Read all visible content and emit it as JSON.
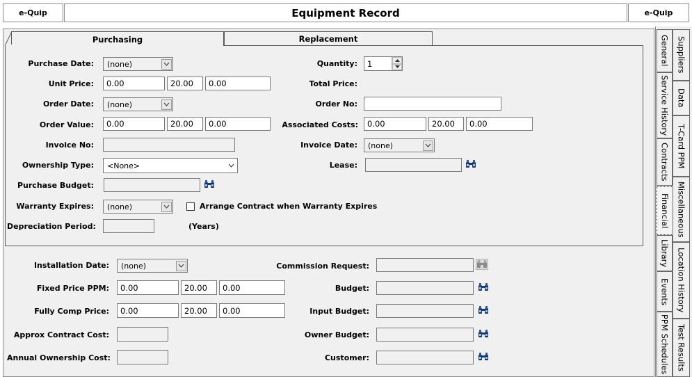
{
  "header": {
    "left_button": "e-Quip",
    "title": "Equipment Record",
    "right_button": "e-Quip"
  },
  "tabs": {
    "purchasing": "Purchasing",
    "replacement": "Replacement"
  },
  "purchasing": {
    "purchase_date_label": "Purchase Date:",
    "purchase_date_value": "(none)",
    "quantity_label": "Quantity:",
    "quantity_value": "1",
    "unit_price_label": "Unit Price:",
    "unit_price_values": [
      "0.00",
      "20.00",
      "0.00"
    ],
    "total_price_label": "Total Price:",
    "order_date_label": "Order Date:",
    "order_date_value": "(none)",
    "order_no_label": "Order No:",
    "order_no_value": "",
    "order_value_label": "Order Value:",
    "order_value_values": [
      "0.00",
      "20.00",
      "0.00"
    ],
    "associated_costs_label": "Associated Costs:",
    "associated_costs_values": [
      "0.00",
      "20.00",
      "0.00"
    ],
    "invoice_no_label": "Invoice No:",
    "invoice_no_value": "",
    "invoice_date_label": "Invoice Date:",
    "invoice_date_value": "(none)",
    "ownership_type_label": "Ownership Type:",
    "ownership_type_value": "<None>",
    "lease_label": "Lease:",
    "lease_value": "",
    "purchase_budget_label": "Purchase Budget:",
    "purchase_budget_value": "",
    "warranty_expires_label": "Warranty Expires:",
    "warranty_expires_value": "(none)",
    "arrange_contract_label": "Arrange Contract when Warranty Expires",
    "arrange_contract_checked": false,
    "depreciation_period_label": "Depreciation Period:",
    "depreciation_period_value": "",
    "years_label": "(Years)"
  },
  "lower": {
    "installation_date_label": "Installation Date:",
    "installation_date_value": "(none)",
    "commission_request_label": "Commission Request:",
    "fixed_price_ppm_label": "Fixed Price PPM:",
    "fixed_price_ppm_values": [
      "0.00",
      "20.00",
      "0.00"
    ],
    "budget_label": "Budget:",
    "fully_comp_price_label": "Fully Comp Price:",
    "fully_comp_price_values": [
      "0.00",
      "20.00",
      "0.00"
    ],
    "input_budget_label": "Input Budget:",
    "approx_contract_cost_label": "Approx Contract Cost:",
    "owner_budget_label": "Owner Budget:",
    "annual_ownership_cost_label": "Annual Ownership Cost:",
    "customer_label": "Customer:"
  },
  "side_tabs": {
    "outer": [
      "Suppliers",
      "Data",
      "T-Card PPM",
      "Miscellaneous",
      "Location History",
      "Test Results"
    ],
    "inner": [
      "General",
      "Service History",
      "Contracts",
      "Financial",
      "Library",
      "Events",
      "PPM Schedules"
    ],
    "active": "Financial"
  }
}
